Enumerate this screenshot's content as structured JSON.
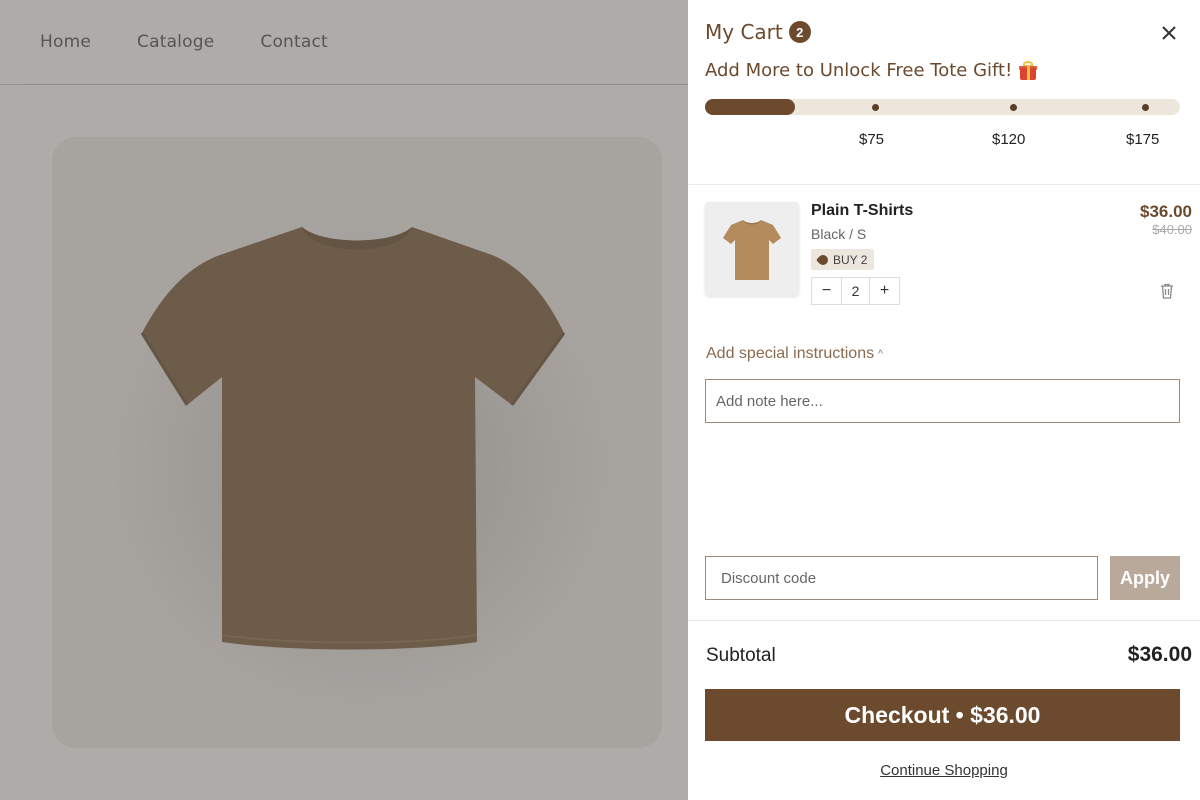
{
  "nav": {
    "items": [
      "Home",
      "Cataloge",
      "Contact"
    ]
  },
  "cart": {
    "title": "My Cart",
    "count": "2",
    "close_icon": "close-icon",
    "promo_text": "Add More to Unlock Free Tote Gift!",
    "progress": {
      "fraction": 0.19,
      "milestones": [
        "$75",
        "$120",
        "$175"
      ]
    },
    "items": [
      {
        "name": "Plain T-Shirts",
        "variant": "Black / S",
        "tag": "BUY 2",
        "quantity": "2",
        "price": "$36.00",
        "compare_price": "$40.00"
      }
    ],
    "instructions_label": "Add special instructions",
    "note_placeholder": "Add note here...",
    "discount_placeholder": "Discount code",
    "apply_label": "Apply",
    "subtotal_label": "Subtotal",
    "subtotal_value": "$36.00",
    "checkout_label": "Checkout • $36.00",
    "continue_label": "Continue Shopping"
  },
  "colors": {
    "brand": "#6b4a2e",
    "apply_button": "#b8a99a",
    "progress_track": "#ede6dd",
    "tshirt": "#7a6143"
  }
}
